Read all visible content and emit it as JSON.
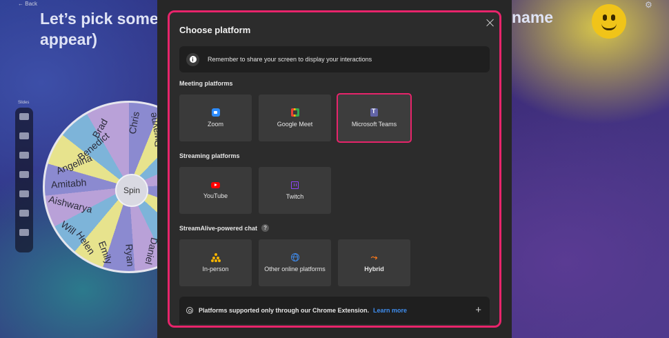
{
  "background": {
    "back_label": "Back",
    "title_left": "Let’s pick some",
    "title_left_line2": "appear)",
    "title_right": "name",
    "slides_label": "Slides",
    "spin_label": "Spin",
    "wheel_names": [
      "Chris",
      "Brad",
      "Benedict",
      "Angelina",
      "Amitabh",
      "Aishwarya",
      "Will",
      "Helen",
      "Emily",
      "Ryan",
      "Daniel",
      "Dwayne"
    ]
  },
  "modal": {
    "title": "Choose platform",
    "notice": "Remember to share your screen to display your interactions",
    "sections": {
      "meeting": {
        "label": "Meeting platforms",
        "cards": [
          "Zoom",
          "Google Meet",
          "Microsoft Teams"
        ]
      },
      "streaming": {
        "label": "Streaming platforms",
        "cards": [
          "YouTube",
          "Twitch"
        ]
      },
      "chat": {
        "label": "StreamAlive-powered chat",
        "cards": [
          "In-person",
          "Other online platforms",
          "Hybrid"
        ]
      }
    },
    "selected": "Microsoft Teams",
    "footer_text": "Platforms supported only through our Chrome Extension.",
    "footer_link": "Learn more",
    "icons": {
      "zoom": "zoom-icon",
      "meet": "google-meet-icon",
      "teams": "microsoft-teams-icon",
      "youtube": "youtube-icon",
      "twitch": "twitch-icon",
      "inperson": "people-icon",
      "online": "globe-icon",
      "hybrid": "hybrid-icon"
    },
    "colors": {
      "highlight": "#e8246b",
      "link": "#3f8ef0",
      "panel": "#2c2c2c"
    }
  }
}
